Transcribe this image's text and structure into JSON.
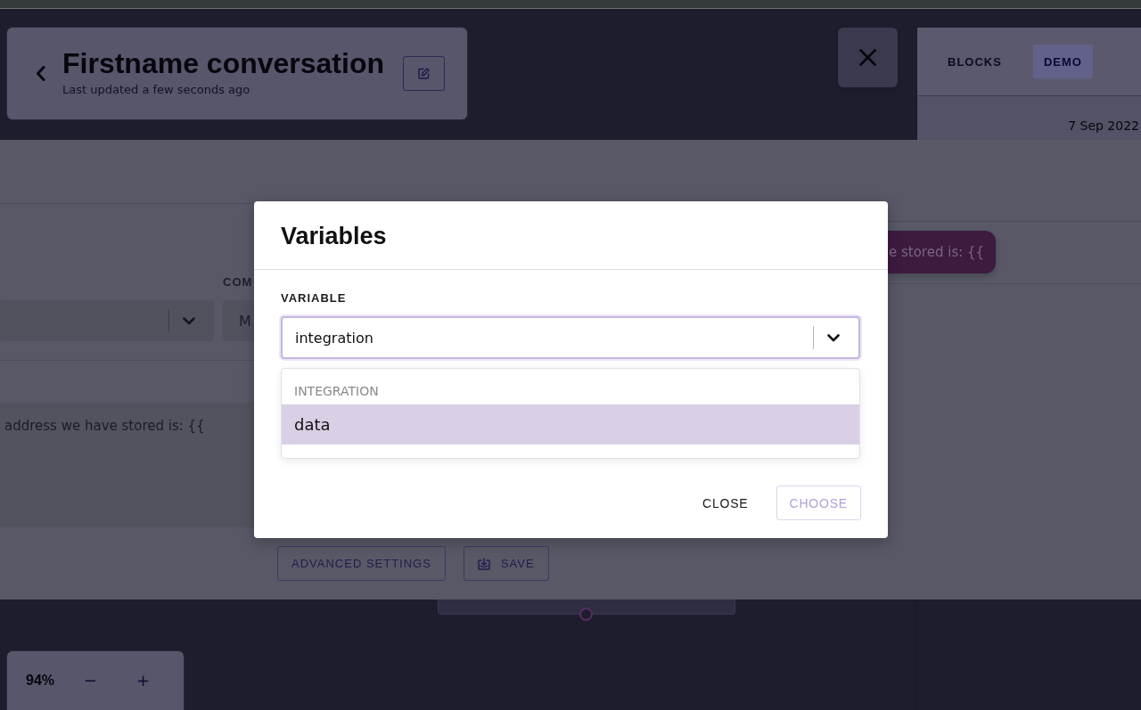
{
  "header": {
    "title": "Firstname conversation",
    "subtitle": "Last updated a few seconds ago"
  },
  "side_panel": {
    "tabs": [
      {
        "label": "BLOCKS",
        "selected": false
      },
      {
        "label": "DEMO",
        "selected": true
      }
    ],
    "date": "7 Sep 2022"
  },
  "editor": {
    "field_label": "COM",
    "field_value": "M",
    "message_text": "address we have stored is: {{",
    "bubble_text": "e stored is: {{",
    "buttons": [
      {
        "label": "ADVANCED SETTINGS",
        "kind": "plain"
      },
      {
        "label": "SAVE",
        "kind": "save"
      }
    ]
  },
  "zoom_control": {
    "level_text": "94%",
    "buttons": [
      "−",
      "+"
    ]
  },
  "modal": {
    "title": "Variables",
    "field_label": "VARIABLE",
    "select": {
      "value": "integration",
      "focused": true,
      "expanded": true,
      "groups": [
        {
          "label": "INTEGRATION",
          "options": [
            {
              "label": "data",
              "selected": true
            }
          ]
        }
      ]
    },
    "buttons": [
      {
        "label": "CLOSE",
        "kind": "text",
        "disabled": false
      },
      {
        "label": "CHOOSE",
        "kind": "outlined",
        "disabled": true
      }
    ]
  }
}
